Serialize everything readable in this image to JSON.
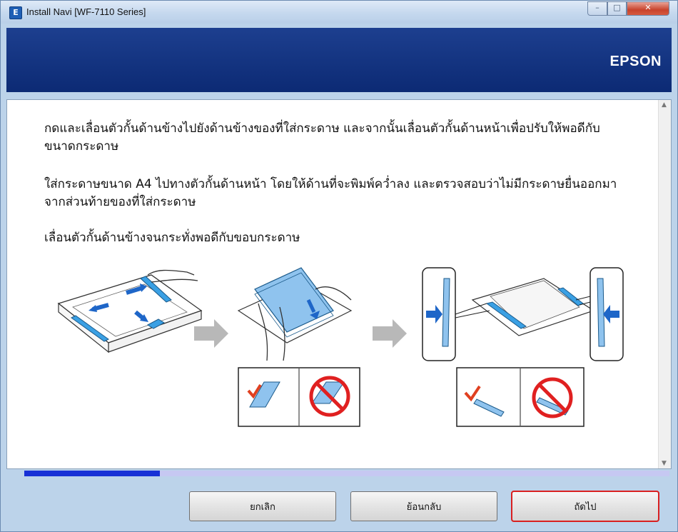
{
  "window": {
    "title": "Install Navi [WF-7110 Series]",
    "app_icon": "E"
  },
  "controls": {
    "minimize": "–",
    "maximize": "□",
    "close": "✕"
  },
  "banner": {
    "brand": "EPSON"
  },
  "instructions": {
    "p1": "กดและเลื่อนตัวกั้นด้านข้างไปยังด้านข้างของที่ใส่กระดาษ และจากนั้นเลื่อนตัวกั้นด้านหน้าเพื่อปรับให้พอดีกับขนาดกระดาษ",
    "p2": "ใส่กระดาษขนาด A4 ไปทางตัวกั้นด้านหน้า โดยให้ด้านที่จะพิมพ์คว่ำลง และตรวจสอบว่าไม่มีกระดาษยื่นออกมาจากส่วนท้ายของที่ใส่กระดาษ",
    "p3": "เลื่อนตัวกั้นด้านข้างจนกระทั่งพอดีกับขอบกระดาษ"
  },
  "progress": {
    "value": 0.21
  },
  "buttons": {
    "cancel": "ยกเลิก",
    "back": "ย้อนกลับ",
    "next": "ถัดไป"
  },
  "colors": {
    "banner": "#0c2a74",
    "progress_fill": "#1730d6",
    "paper": "#8fc3ee",
    "guide": "#3aa0e4",
    "check": "#e04020",
    "prohibit": "#e02020"
  }
}
